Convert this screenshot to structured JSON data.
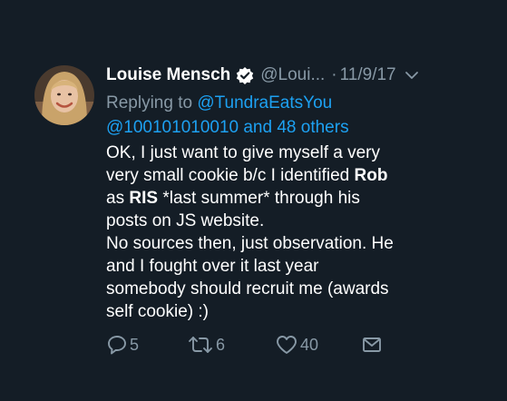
{
  "tweet": {
    "author": {
      "display_name": "Louise Mensch",
      "handle": "@Loui...",
      "verified": true
    },
    "separator": "·",
    "date": "11/9/17",
    "replying_to": {
      "prefix": "Replying to",
      "first_mention": "@TundraEatsYou",
      "second_line": "@100101010010 and 48 others"
    },
    "text": {
      "l1": "OK, I just want to give myself a very",
      "l2_pre": "very small cookie b/c I identified ",
      "l2_bold": "Rob",
      "l3_pre": "as ",
      "l3_bold": "RIS",
      "l3_post": " *last summer* through his",
      "l4": "posts on JS website.",
      "l5": "No sources then, just observation. He",
      "l6": "and I fought over it last year",
      "l7": "somebody should recruit me (awards",
      "l8": "self cookie)  :)"
    },
    "actions": {
      "reply_count": "5",
      "retweet_count": "6",
      "like_count": "40"
    }
  },
  "icons": {
    "verified": "verified-badge-icon",
    "menu": "chevron-down-icon",
    "reply": "reply-bubble-icon",
    "retweet": "retweet-icon",
    "like": "heart-icon",
    "dm": "envelope-icon"
  },
  "colors": {
    "background": "#141d26",
    "text": "#ffffff",
    "secondary": "#8899a6",
    "link": "#1da1f2"
  }
}
